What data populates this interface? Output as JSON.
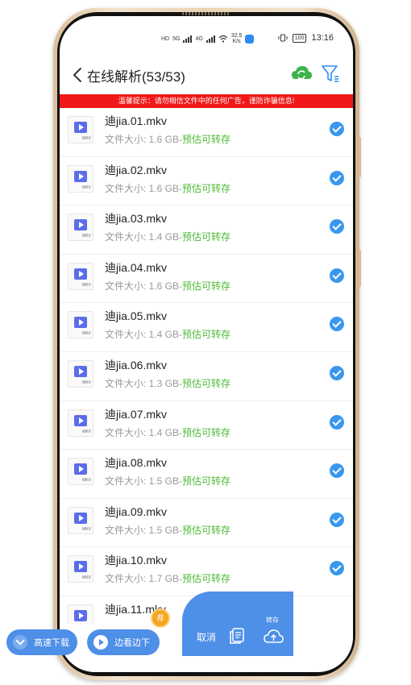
{
  "status_bar": {
    "net_left": "HD",
    "net_5g": "5G",
    "net_4g": "4G",
    "speed_value": "32.5",
    "speed_unit": "K/s",
    "battery": "100",
    "time": "13:16"
  },
  "header": {
    "title": "在线解析(53/53)"
  },
  "notice": "温馨提示：请勿相信文件中的任何广告，谨防诈骗信息!",
  "files": [
    {
      "name": "迪jia.01.mkv",
      "size": "文件大小: 1.6 GB",
      "sep": "-",
      "status": "预估可转存",
      "ext": "MKV"
    },
    {
      "name": "迪jia.02.mkv",
      "size": "文件大小: 1.6 GB",
      "sep": "-",
      "status": "预估可转存",
      "ext": "MKV"
    },
    {
      "name": "迪jia.03.mkv",
      "size": "文件大小: 1.4 GB",
      "sep": "-",
      "status": "预估可转存",
      "ext": "MKV"
    },
    {
      "name": "迪jia.04.mkv",
      "size": "文件大小: 1.6 GB",
      "sep": "-",
      "status": "预估可转存",
      "ext": "MKV"
    },
    {
      "name": "迪jia.05.mkv",
      "size": "文件大小: 1.4 GB",
      "sep": "-",
      "status": "预估可转存",
      "ext": "MKV"
    },
    {
      "name": "迪jia.06.mkv",
      "size": "文件大小: 1.3 GB",
      "sep": "-",
      "status": "预估可转存",
      "ext": "MKV"
    },
    {
      "name": "迪jia.07.mkv",
      "size": "文件大小: 1.4 GB",
      "sep": "-",
      "status": "预估可转存",
      "ext": "MKV"
    },
    {
      "name": "迪jia.08.mkv",
      "size": "文件大小: 1.5 GB",
      "sep": "-",
      "status": "预估可转存",
      "ext": "MKV"
    },
    {
      "name": "迪jia.09.mkv",
      "size": "文件大小: 1.5 GB",
      "sep": "-",
      "status": "预估可转存",
      "ext": "MKV"
    },
    {
      "name": "迪jia.10.mkv",
      "size": "文件大小: 1.7 GB",
      "sep": "-",
      "status": "预估可转存",
      "ext": "MKV"
    },
    {
      "name": "迪jia.11.mkv",
      "size": "",
      "sep": "",
      "status": "",
      "ext": "MKV"
    }
  ],
  "bottom": {
    "fast_download": "高速下载",
    "watch_while_download": "边看边下",
    "badge": "荐",
    "cancel": "取消",
    "transfer": "转存"
  },
  "colors": {
    "accent": "#4e8fe8",
    "notice_bg": "#f01818",
    "ok_green": "#4dbb36",
    "check_blue": "#3a97ee"
  },
  "icons": [
    "back-arrow-icon",
    "cloud-sync-icon",
    "filter-icon",
    "video-file-icon",
    "check-icon",
    "download-icon",
    "play-icon",
    "copy-icon",
    "cloud-upload-icon"
  ]
}
